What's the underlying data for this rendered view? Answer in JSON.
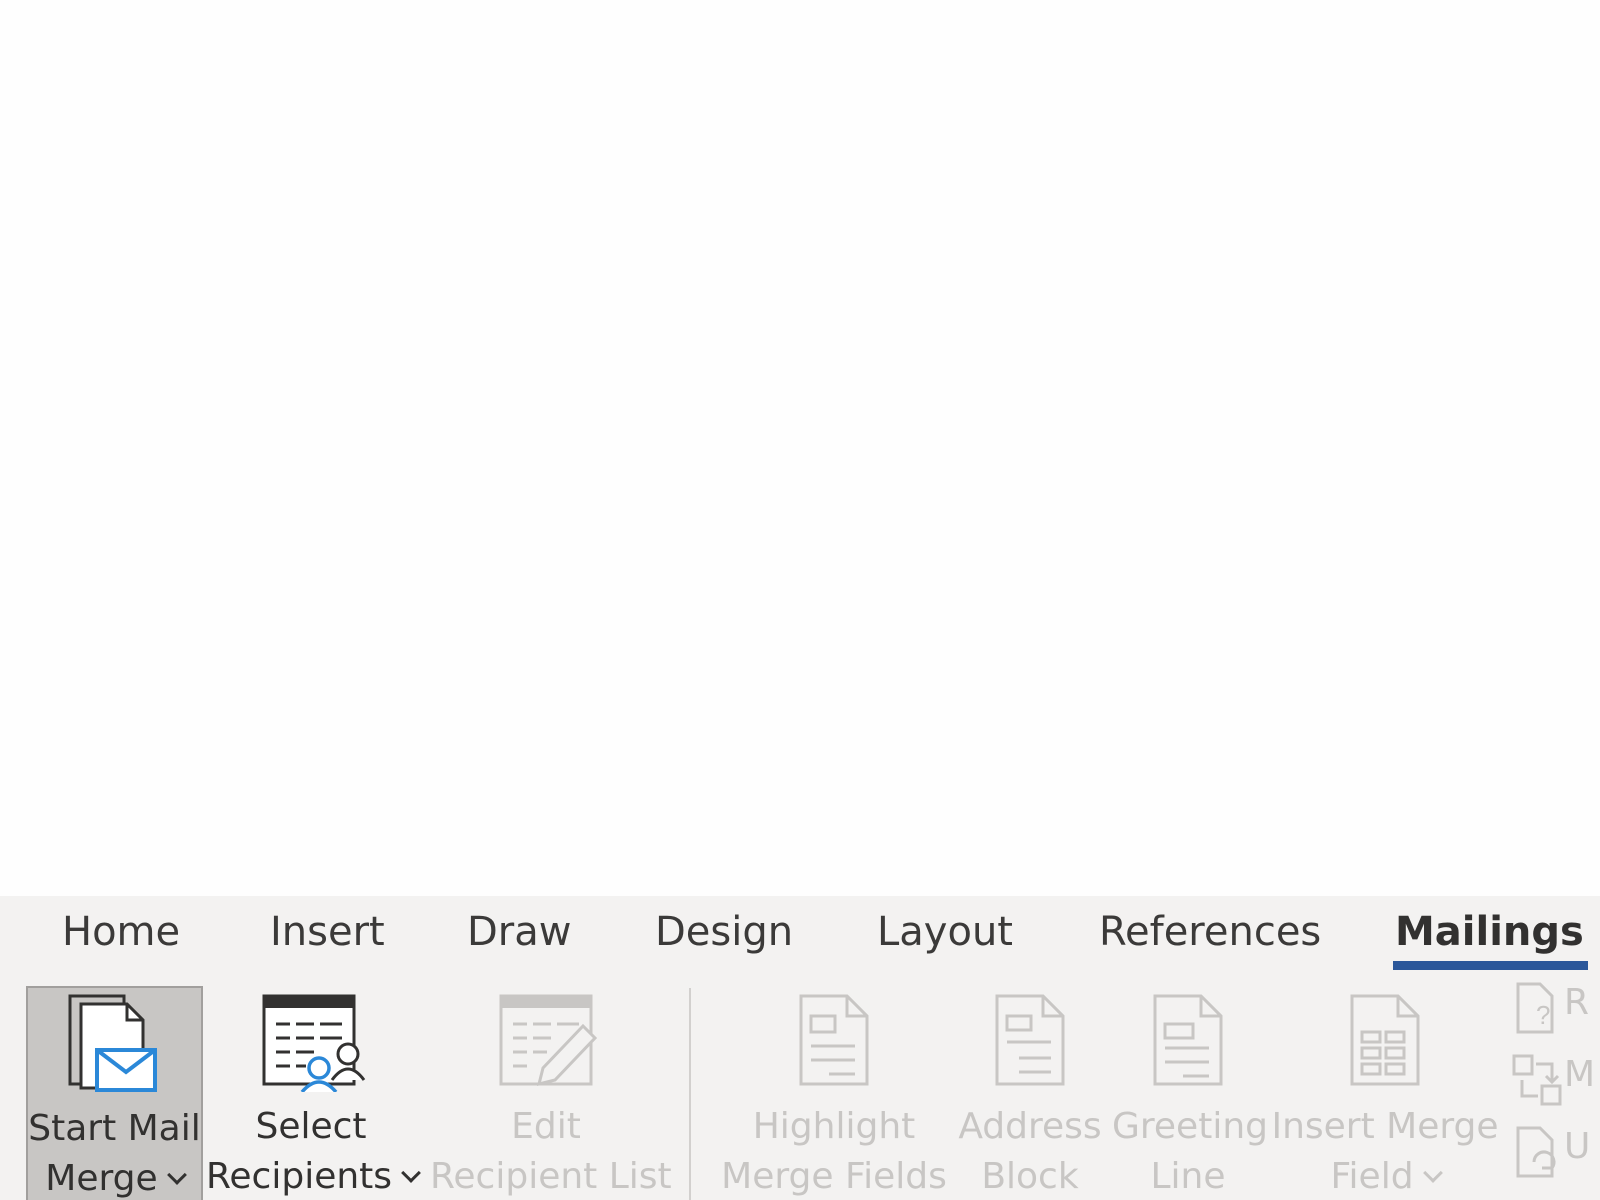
{
  "ribbon": {
    "tabs": [
      {
        "label": "Home"
      },
      {
        "label": "Insert"
      },
      {
        "label": "Draw"
      },
      {
        "label": "Design"
      },
      {
        "label": "Layout"
      },
      {
        "label": "References"
      },
      {
        "label": "Mailings"
      }
    ],
    "active_tab": "Mailings",
    "accent_color": "#2b579a",
    "commands": {
      "start_mail_merge": {
        "line1": "Start Mail",
        "line2": "Merge",
        "icon": "start-mail-merge-icon"
      },
      "select_recipients": {
        "line1": "Select",
        "line2": "Recipients",
        "icon": "select-recipients-icon"
      },
      "edit_recipient_list": {
        "line1": "Edit",
        "line2": "Recipient List",
        "icon": "edit-recipient-list-icon"
      },
      "highlight_merge_fields": {
        "line1": "Highlight",
        "line2": "Merge Fields",
        "icon": "highlight-merge-fields-icon"
      },
      "address_block": {
        "line1": "Address",
        "line2": "Block",
        "icon": "address-block-icon"
      },
      "greeting_line": {
        "line1": "Greeting",
        "line2": "Line",
        "icon": "greeting-line-icon"
      },
      "insert_merge_field": {
        "line1": "Insert Merge",
        "line2": "Field",
        "icon": "insert-merge-field-icon"
      }
    },
    "small_commands": [
      {
        "label": "R",
        "icon": "rules-icon"
      },
      {
        "label": "M",
        "icon": "match-fields-icon"
      },
      {
        "label": "U",
        "icon": "update-labels-icon"
      }
    ]
  }
}
